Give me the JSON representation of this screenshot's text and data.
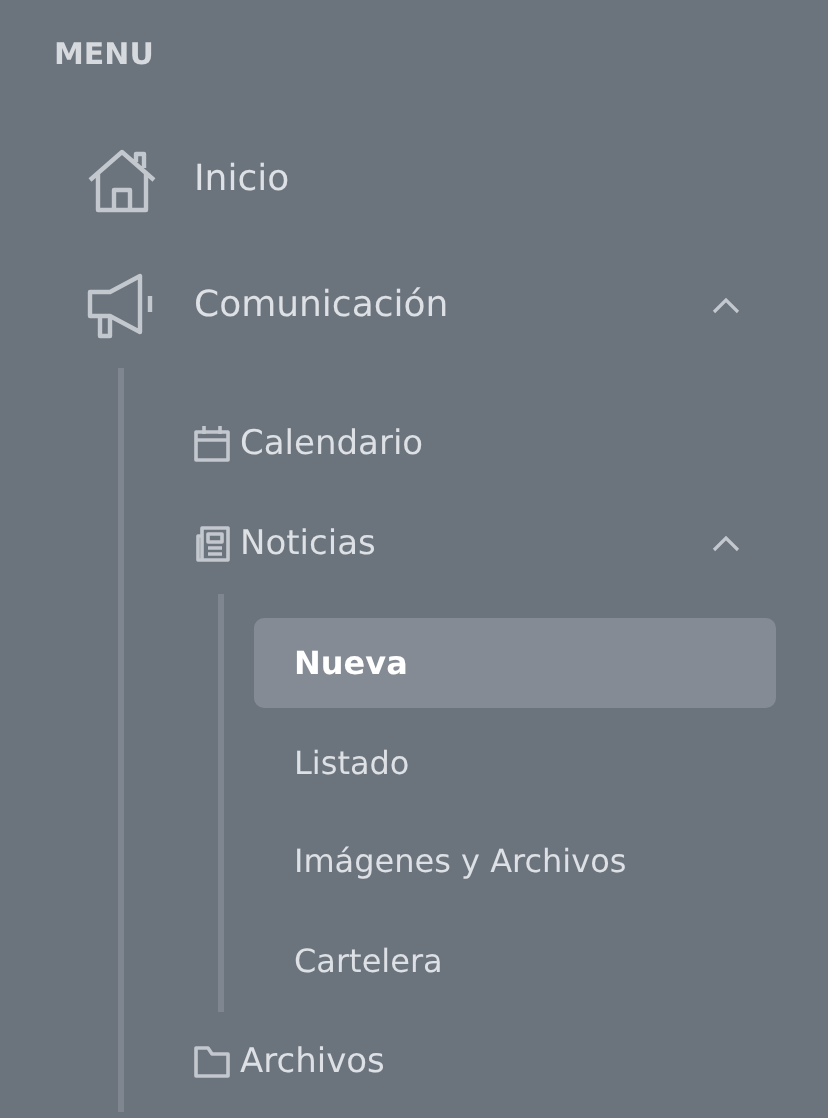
{
  "menu": {
    "title": "MENU",
    "items": [
      {
        "label": "Inicio",
        "kind": "home",
        "selected": false
      },
      {
        "label": "Comunicación",
        "kind": "megaphone",
        "selected": false,
        "expanded": true,
        "children": [
          {
            "label": "Calendario",
            "kind": "calendar",
            "selected": false
          },
          {
            "label": "Noticias",
            "kind": "newspaper",
            "selected": false,
            "expanded": true,
            "children": [
              {
                "label": "Nueva",
                "selected": true
              },
              {
                "label": "Listado",
                "selected": false
              },
              {
                "label": "Imágenes y Archivos",
                "selected": false
              },
              {
                "label": "Cartelera",
                "selected": false
              }
            ]
          },
          {
            "label": "Archivos",
            "kind": "folder",
            "selected": false
          }
        ]
      }
    ]
  }
}
